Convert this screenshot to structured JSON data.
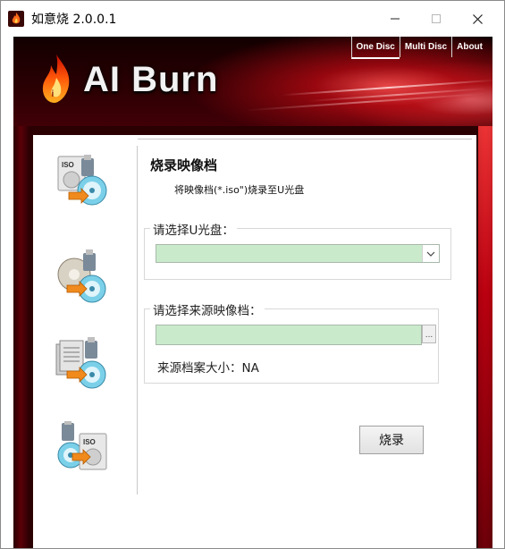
{
  "window": {
    "title": "如意烧 2.0.0.1",
    "controls": {
      "minimize_icon": "minimize-icon",
      "maximize_icon": "maximize-icon",
      "close_icon": "close-icon"
    }
  },
  "banner": {
    "brand": "AI Burn",
    "tabs": [
      {
        "label": "One Disc",
        "active": true
      },
      {
        "label": "Multi Disc",
        "active": false
      },
      {
        "label": "About",
        "active": false
      }
    ]
  },
  "sidebar": {
    "items": [
      {
        "icon": "iso-usb-to-disc-icon",
        "active": true
      },
      {
        "icon": "disc-copy-icon",
        "active": false
      },
      {
        "icon": "files-to-disc-icon",
        "active": false
      },
      {
        "icon": "usb-disc-to-iso-icon",
        "active": false
      }
    ]
  },
  "main": {
    "title": "烧录映像档",
    "description": "将映像档(*.iso\")烧录至U光盘",
    "drive_group": {
      "legend": "请选择U光盘：",
      "selected_value": ""
    },
    "source_group": {
      "legend": "请选择来源映像档：",
      "file_value": "",
      "browse_label": "...",
      "size_label": "来源档案大小：NA"
    },
    "burn_button": "烧录"
  },
  "colors": {
    "input_bg": "#c9ebcb",
    "banner_dark": "#2a0003",
    "banner_accent": "#d4101e"
  }
}
